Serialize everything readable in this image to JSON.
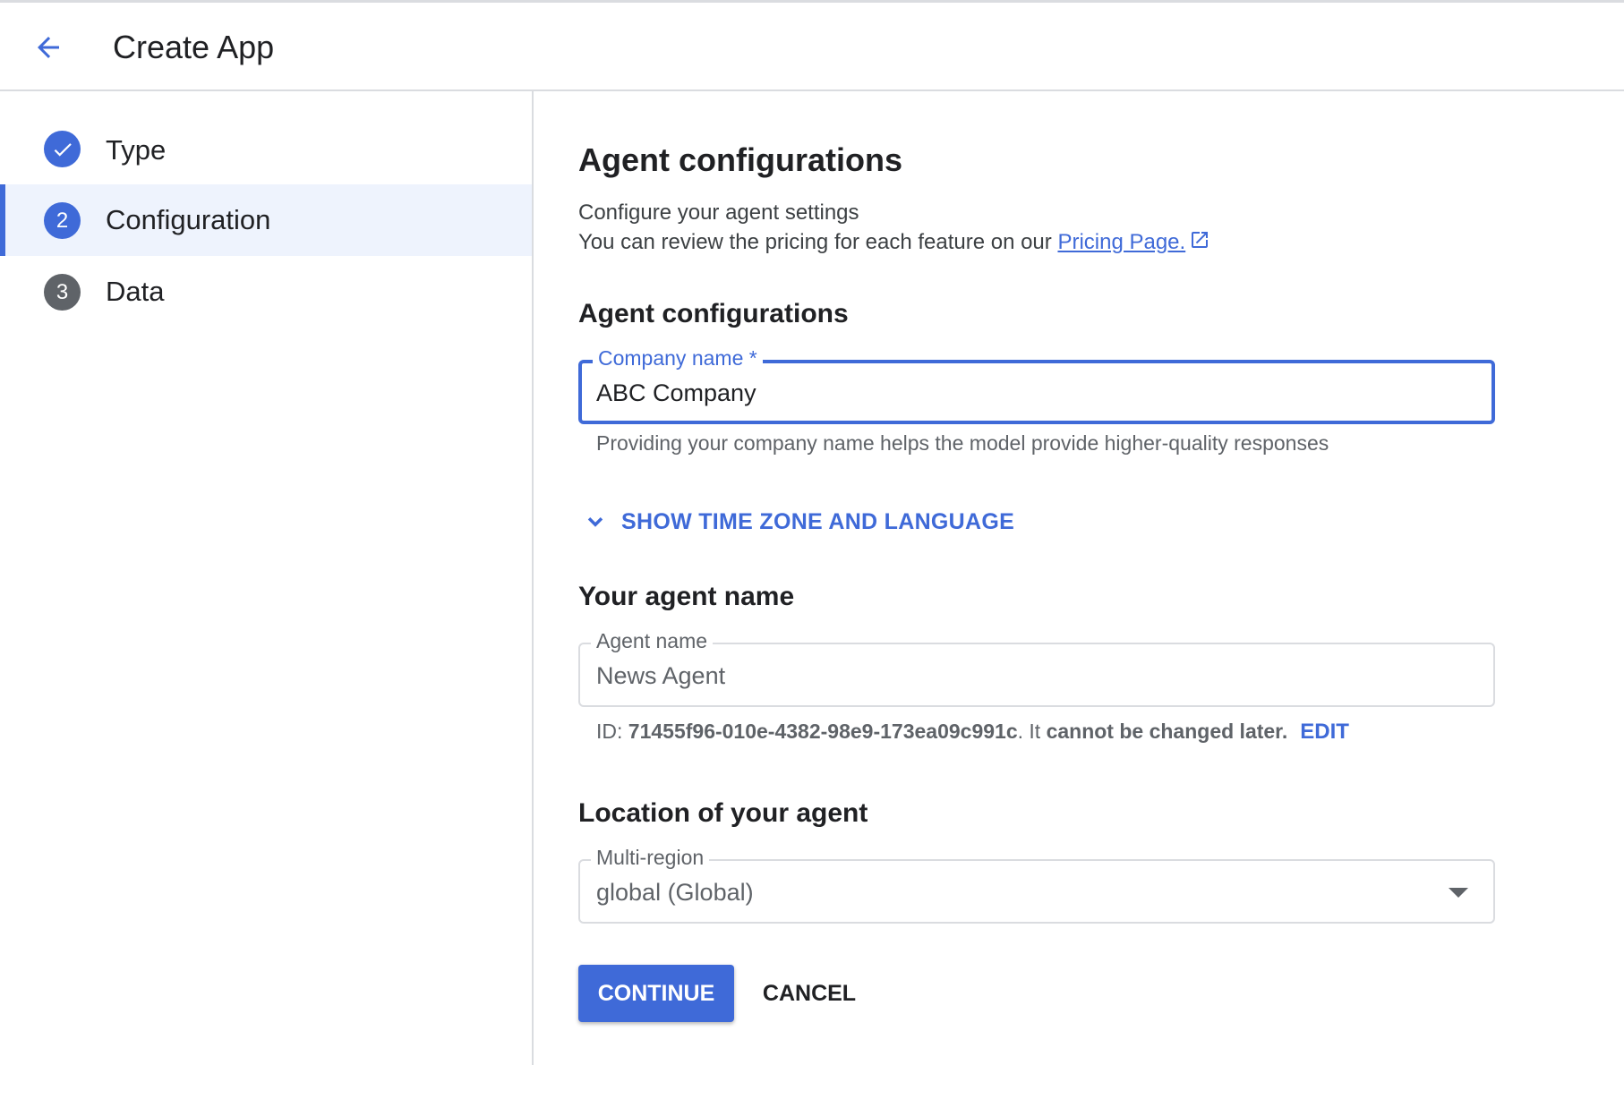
{
  "header": {
    "title": "Create App",
    "back_icon": "arrow-back-icon"
  },
  "steps": [
    {
      "label": "Type",
      "badge": "",
      "state": "done",
      "icon": "check-circle-icon"
    },
    {
      "label": "Configuration",
      "badge": "2",
      "state": "active"
    },
    {
      "label": "Data",
      "badge": "3",
      "state": "pending"
    }
  ],
  "main": {
    "title": "Agent configurations",
    "description_line1": "Configure your agent settings",
    "description_line2_prefix": "You can review the pricing for each feature on our ",
    "pricing_link": "Pricing Page.",
    "external_icon": "open-in-new-icon",
    "config_section": {
      "heading": "Agent configurations",
      "company_field": {
        "label": "Company name *",
        "value": "ABC Company",
        "hint": "Providing your company name helps the model provide higher-quality responses"
      },
      "toggle_label": "SHOW TIME ZONE AND LANGUAGE"
    },
    "agent_name_section": {
      "heading": "Your agent name",
      "field": {
        "label": "Agent name",
        "value": "News Agent"
      },
      "id_prefix": "ID: ",
      "id_value": "71455f96-010e-4382-98e9-173ea09c991c",
      "id_mid": ". It ",
      "id_suffix": "cannot be changed later.",
      "edit_label": "EDIT"
    },
    "location_section": {
      "heading": "Location of your agent",
      "field": {
        "label": "Multi-region",
        "value": "global (Global)"
      }
    },
    "buttons": {
      "continue": "CONTINUE",
      "cancel": "CANCEL"
    }
  },
  "colors": {
    "accent": "#3f6ad8",
    "active_step_bg": "#eef3fd",
    "border": "#dadce0"
  }
}
